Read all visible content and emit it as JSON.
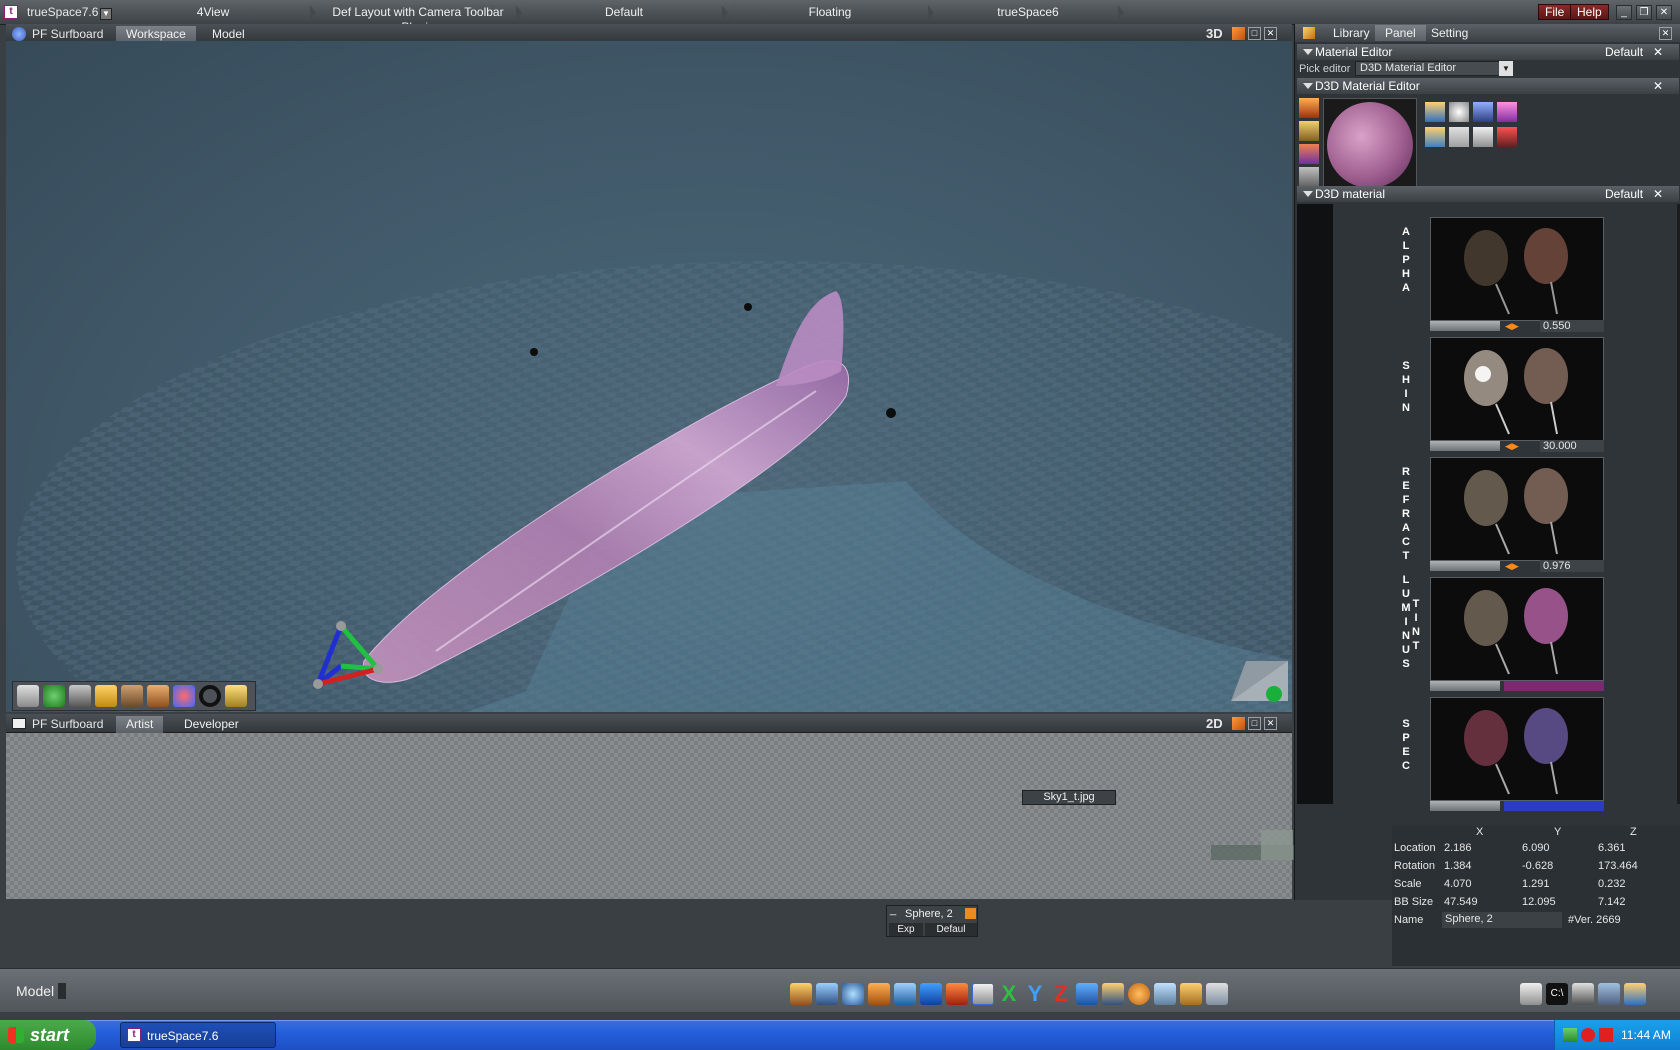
{
  "app": {
    "title": "trueSpace7.6"
  },
  "topbar": {
    "segments": [
      "4View",
      "Def Layout with Camera Toolbar Plugin",
      "Default",
      "Floating",
      "trueSpace6"
    ],
    "file_label": "File",
    "help_label": "Help"
  },
  "viewport3d": {
    "scene_name": "PF Surfboard",
    "tabs": [
      "Workspace",
      "Model"
    ],
    "mode_label": "3D"
  },
  "view2d": {
    "scene_name": "PF Surfboard",
    "tabs": [
      "Artist",
      "Developer"
    ],
    "mode_label": "2D",
    "texture_node": "Sky1_t.jpg",
    "sphere_node": {
      "title": "Sphere, 2",
      "ports": [
        "Exp",
        "Defaul"
      ]
    }
  },
  "rightpanel": {
    "tabs": [
      "Library",
      "Panel",
      "Setting"
    ],
    "material_editor": {
      "title": "Material Editor",
      "preset": "Default",
      "pick_label": "Pick editor",
      "pick_value": "D3D Material Editor"
    },
    "d3d_editor": {
      "title": "D3D Material Editor"
    },
    "d3d_material": {
      "title": "D3D material",
      "preset": "Default",
      "rows": [
        {
          "label": "ALPHA",
          "value": "0.550"
        },
        {
          "label": "SHIN",
          "value": "30.000"
        },
        {
          "label": "REFRACT",
          "value": "0.976"
        },
        {
          "label": "LUMINUS",
          "label2": "TINT",
          "color": "#7a2a6e"
        },
        {
          "label": "SPEC",
          "color": "#2c3cc0"
        }
      ]
    }
  },
  "props": {
    "headers": [
      "X",
      "Y",
      "Z"
    ],
    "rows": [
      {
        "label": "Location",
        "values": [
          "2.186",
          "6.090",
          "6.361"
        ]
      },
      {
        "label": "Rotation",
        "values": [
          "1.384",
          "-0.628",
          "173.464"
        ]
      },
      {
        "label": "Scale",
        "values": [
          "4.070",
          "1.291",
          "0.232"
        ]
      },
      {
        "label": "BB Size",
        "values": [
          "47.549",
          "12.095",
          "7.142"
        ]
      }
    ],
    "name_label": "Name",
    "name_value": "Sphere, 2",
    "version": "#Ver. 2669"
  },
  "bottombar": {
    "mode_label": "Model"
  },
  "taskbar": {
    "start_label": "start",
    "task_label": "trueSpace7.6",
    "clock": "11:44 AM"
  }
}
